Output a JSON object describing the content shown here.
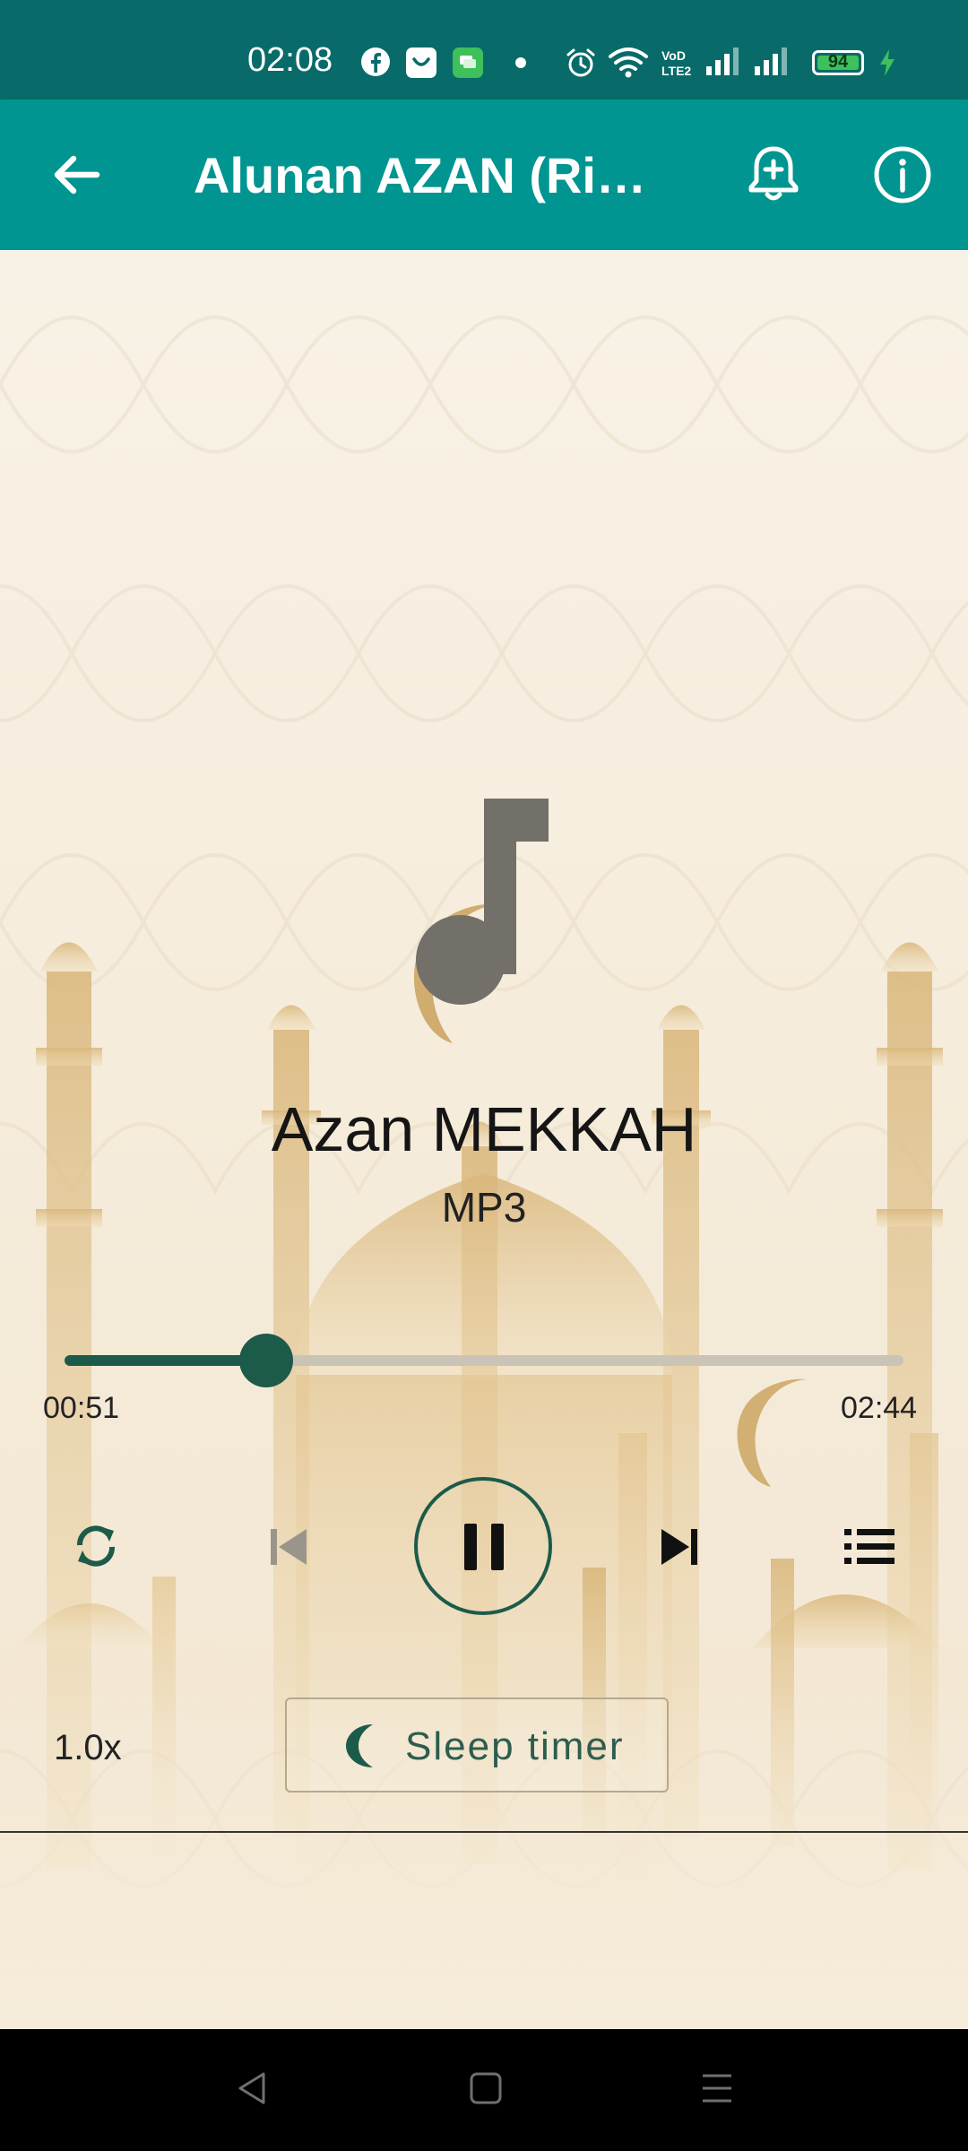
{
  "status_bar": {
    "time": "02:08",
    "battery": "94",
    "icons": [
      "facebook-icon",
      "face-app-icon",
      "messages-icon",
      "dot-icon",
      "alarm-icon",
      "wifi-icon",
      "volte-icon",
      "signal-icon",
      "signal-icon",
      "charging-icon"
    ]
  },
  "app_bar": {
    "title": "Alunan AZAN (Ringtone)",
    "icons": [
      "back-arrow-icon",
      "add-notification-icon",
      "info-icon"
    ]
  },
  "player": {
    "title": "Azan MEKKAH",
    "subtitle": "MP3",
    "current_time": "00:51",
    "total_time": "02:44",
    "progress": 0.24,
    "controls": [
      "repeat-icon",
      "skip-previous-icon",
      "pause-icon",
      "skip-next-icon",
      "playlist-icon"
    ],
    "speed": "1.0x",
    "sleep_timer_label": "Sleep timer"
  },
  "nav_bar": {
    "icons": [
      "back-icon",
      "home-icon",
      "recents-icon"
    ]
  },
  "colors": {
    "status_bar": "#086b69",
    "app_bar": "#009591",
    "accent": "#1c5b4a",
    "background": "#f6efe2"
  }
}
